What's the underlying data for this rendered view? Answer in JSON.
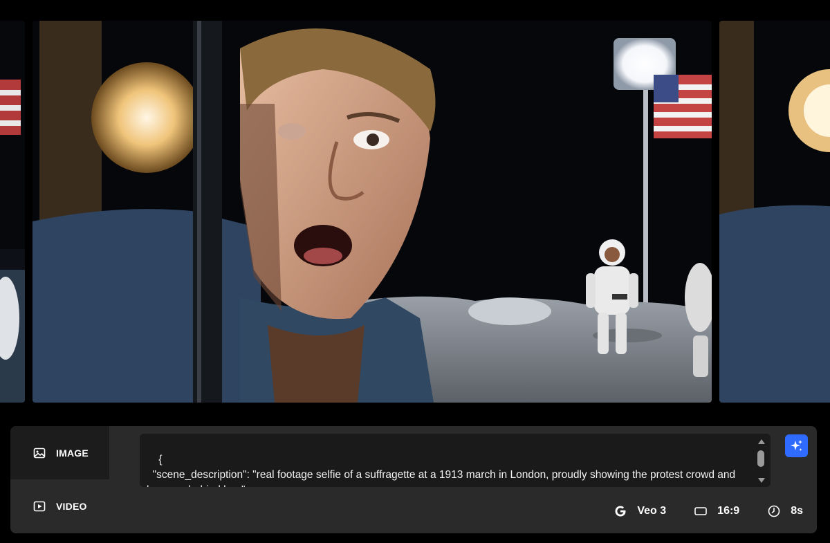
{
  "modes": [
    {
      "label": "IMAGE",
      "icon": "image-icon",
      "active": true
    },
    {
      "label": "VIDEO",
      "icon": "play-icon",
      "active": false
    }
  ],
  "prompt": {
    "text": "{\n  \"scene_description\": \"real footage selfie of a suffragette at a 1913 march in London, proudly showing the protest crowd and banners behind her.\","
  },
  "options": {
    "model": "Veo 3",
    "aspect": "16:9",
    "duration": "8s"
  },
  "colors": {
    "accent": "#2f6bff",
    "panel": "#2a2a2a",
    "prompt_bg": "#1a1a1a"
  }
}
